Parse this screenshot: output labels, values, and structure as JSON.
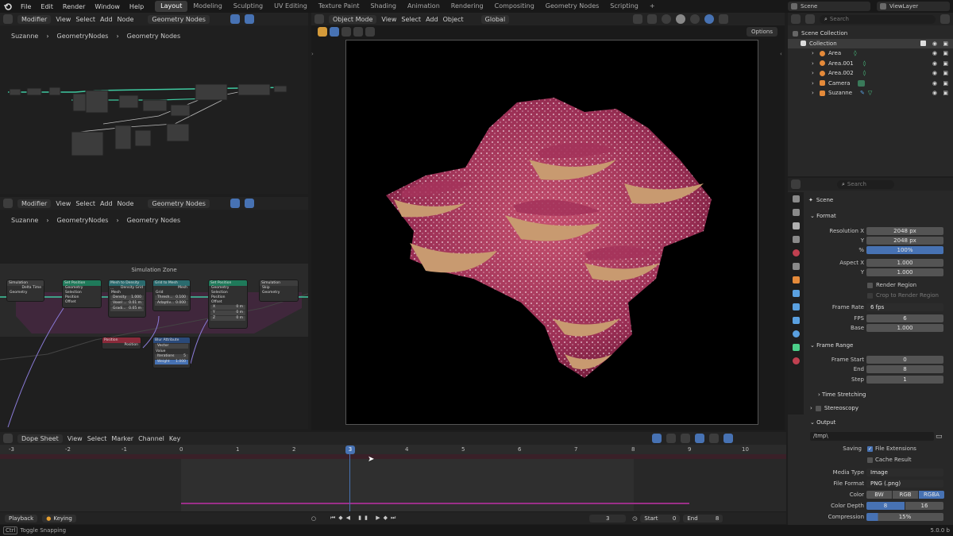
{
  "topbar": {
    "menus": [
      "File",
      "Edit",
      "Render",
      "Window",
      "Help"
    ],
    "workspaces": [
      "Layout",
      "Modeling",
      "Sculpting",
      "UV Editing",
      "Texture Paint",
      "Shading",
      "Animation",
      "Rendering",
      "Compositing",
      "Geometry Nodes",
      "Scripting"
    ],
    "active_workspace": "Layout",
    "scene": "Scene",
    "view_layer": "ViewLayer"
  },
  "node_editor_top": {
    "editor": "Modifier",
    "menus": [
      "View",
      "Select",
      "Add",
      "Node"
    ],
    "tree": "Geometry Nodes",
    "breadcrumb": [
      "Suzanne",
      "GeometryNodes",
      "Geometry Nodes"
    ]
  },
  "node_editor_bottom": {
    "editor": "Modifier",
    "menus": [
      "View",
      "Select",
      "Add",
      "Node"
    ],
    "tree": "Geometry Nodes",
    "breadcrumb": [
      "Suzanne",
      "GeometryNodes",
      "Geometry Nodes"
    ],
    "zone_title": "Simulation Zone",
    "nodes": {
      "sim_in": {
        "title": "Simulation",
        "rows": [
          "Delta Time",
          "Geometry"
        ]
      },
      "set_pos1": {
        "title": "Set Position",
        "rows": [
          "Geometry",
          "Selection",
          "Position",
          "Offset"
        ]
      },
      "mesh_density": {
        "title": "Mesh to Density ...",
        "rows": [
          "Density Grid",
          "Mesh",
          "Density",
          "Voxel ...",
          "Gradi..."
        ],
        "values": [
          "1.000",
          "0.01 m",
          "0.05 m"
        ]
      },
      "grid_mesh": {
        "title": "Grid to Mesh",
        "rows": [
          "Mesh",
          "Grid",
          "Thresh...",
          "Adaptiv..."
        ],
        "values": [
          "0.100",
          "0.000"
        ]
      },
      "set_pos2": {
        "title": "Set Position",
        "rows": [
          "Geometry",
          "Selection",
          "Position",
          "Offset"
        ],
        "xyz": [
          [
            "X",
            "0 m"
          ],
          [
            "Y",
            "0 m"
          ],
          [
            "Z",
            "0 m"
          ]
        ]
      },
      "sim_out": {
        "title": "Simulation",
        "rows": [
          "Skip",
          "Geometry"
        ]
      },
      "position": {
        "title": "Position",
        "rows": [
          "Position"
        ]
      },
      "blur": {
        "title": "Blur Attribute",
        "rows": [
          "Vector",
          "Value",
          "Iterations",
          "Weight"
        ],
        "values": [
          "5",
          "1.000"
        ]
      }
    }
  },
  "viewport": {
    "mode": "Object Mode",
    "menus": [
      "View",
      "Select",
      "Add",
      "Object"
    ],
    "orientation": "Global",
    "options": "Options"
  },
  "outliner": {
    "search": "Search",
    "title": "Scene Collection",
    "collection": "Collection",
    "items": [
      "Area",
      "Area.001",
      "Area.002",
      "Camera",
      "Suzanne"
    ]
  },
  "properties": {
    "search": "Search",
    "context": "Scene",
    "format": {
      "title": "Format",
      "res_x_label": "Resolution X",
      "res_x": "2048 px",
      "res_y_label": "Y",
      "res_y": "2048 px",
      "pct_label": "%",
      "pct": "100%",
      "aspect_x_label": "Aspect X",
      "aspect_x": "1.000",
      "aspect_y_label": "Y",
      "aspect_y": "1.000",
      "render_region": "Render Region",
      "crop": "Crop to Render Region",
      "frame_rate_label": "Frame Rate",
      "frame_rate": "6 fps",
      "fps_label": "FPS",
      "fps": "6",
      "base_label": "Base",
      "base": "1.000"
    },
    "frame_range": {
      "title": "Frame Range",
      "start_label": "Frame Start",
      "start": "0",
      "end_label": "End",
      "end": "8",
      "step_label": "Step",
      "step": "1",
      "time_stretching": "Time Stretching"
    },
    "stereoscopy": "Stereoscopy",
    "output": {
      "title": "Output",
      "path": "/tmp\\",
      "saving_label": "Saving",
      "file_ext": "File Extensions",
      "cache_result": "Cache Result",
      "media_type_label": "Media Type",
      "media_type": "Image",
      "file_format_label": "File Format",
      "file_format": "PNG (.png)",
      "color_label": "Color",
      "color_opts": [
        "BW",
        "RGB",
        "RGBA"
      ],
      "color_depth_label": "Color Depth",
      "depths": [
        "8",
        "16"
      ],
      "compression_label": "Compression",
      "compression": "15%"
    }
  },
  "dopesheet": {
    "editor": "Dope Sheet",
    "menus": [
      "View",
      "Select",
      "Marker",
      "Channel",
      "Key"
    ],
    "ticks": [
      "-3",
      "-2",
      "-1",
      "0",
      "1",
      "2",
      "3",
      "4",
      "5",
      "6",
      "7",
      "8",
      "9",
      "10"
    ],
    "current_frame": "3"
  },
  "timeline": {
    "playback": "Playback",
    "keying": "Keying",
    "frame": "3",
    "start_label": "Start",
    "start": "0",
    "end_label": "End",
    "end": "8"
  },
  "statusbar": {
    "key": "Ctrl",
    "hint": "Toggle Snapping",
    "version": "5.0.0 b"
  },
  "colors": {
    "accent": "#4772b3",
    "teal": "#3fc9a0",
    "magenta": "#a3306b"
  }
}
